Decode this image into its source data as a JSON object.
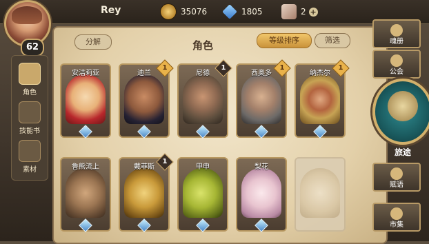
{
  "player": {
    "name": "Rey",
    "level": "62"
  },
  "resources": {
    "gold": "35076",
    "crystal": "1805",
    "tickets": "2"
  },
  "left_nav": [
    {
      "label": "角色"
    },
    {
      "label": "技能书"
    },
    {
      "label": "素材"
    }
  ],
  "panel": {
    "title": "角色",
    "split_label": "分解",
    "sort_label": "等级排序",
    "filter_label": "筛选"
  },
  "characters": [
    {
      "name": "安洁莉亚",
      "badge": "1",
      "badge_style": "gold"
    },
    {
      "name": "迪兰",
      "badge": "1",
      "badge_style": "gold"
    },
    {
      "name": "尼德",
      "badge": "1",
      "badge_style": "dark"
    },
    {
      "name": "西奥多",
      "badge": "1",
      "badge_style": "gold"
    },
    {
      "name": "纳杰尔",
      "badge": "",
      "badge_style": "gold"
    },
    {
      "name": "鲁熊流上",
      "badge": "",
      "badge_style": ""
    },
    {
      "name": "戴菲斯",
      "badge": "1",
      "badge_style": "dark"
    },
    {
      "name": "甲申",
      "badge": "",
      "badge_style": ""
    },
    {
      "name": "梨花",
      "badge": "",
      "badge_style": ""
    },
    {
      "name": "",
      "badge": "",
      "badge_style": "",
      "locked": true
    }
  ],
  "right_nav": {
    "codex": "魂册",
    "guild": "公会",
    "travel": "旅途",
    "talent": "赋语",
    "market": "市集"
  },
  "colors": {
    "accent": "#c9a86b",
    "parchment": "#e3d0a9",
    "teal": "#2f8a8f"
  }
}
